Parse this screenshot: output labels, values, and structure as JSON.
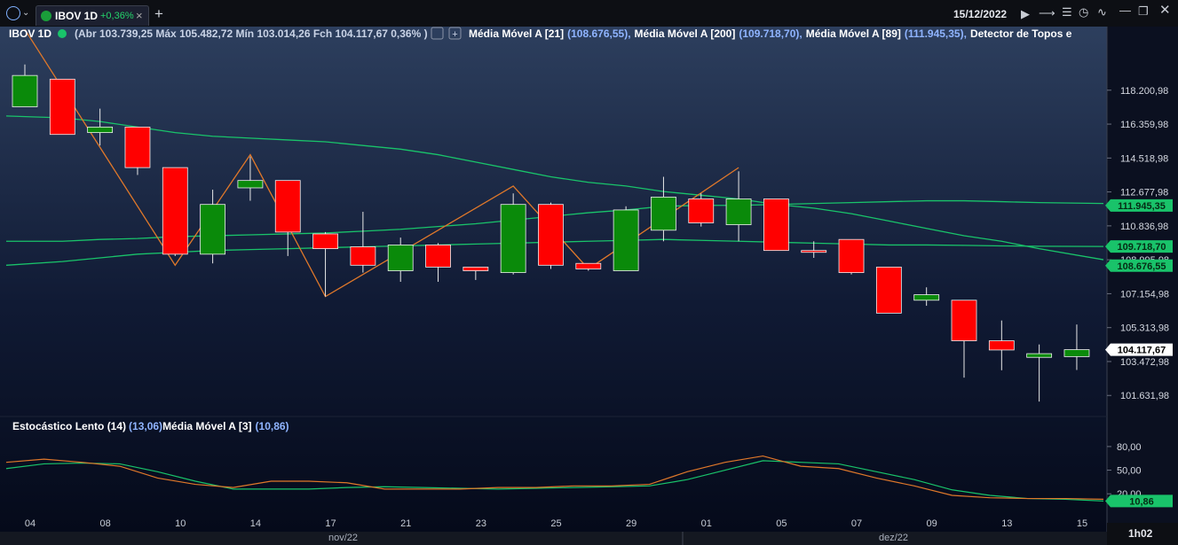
{
  "header": {
    "tab_label": "IBOV 1D",
    "tab_change": "+0,36%",
    "date": "15/12/2022",
    "add_tab": "+"
  },
  "legend": {
    "symbol": "IBOV 1D",
    "ohlc_text": "(Abr 103.739,25 Máx 105.482,72 Mín 103.014,26 Fch 104.117,67 0,36% )",
    "ma21": "Média Móvel A [21]",
    "ma21_val": "(108.676,55),",
    "ma200": "Média Móvel A [200]",
    "ma200_val": "(109.718,70),",
    "ma89": "Média Móvel A [89]",
    "ma89_val": "(111.945,35),",
    "detector": "Detector de Topos e"
  },
  "stoch_legend": {
    "name": "Estocástico Lento (14)",
    "val": "(13,06)",
    "ma": "Média Móvel A [3]",
    "ma_val": "(10,86)"
  },
  "footer": {
    "month1": "nov/22",
    "month2": "dez/22",
    "timer": "1h02"
  },
  "colors": {
    "up": "#0a8a0a",
    "down": "#ff0000",
    "ma_line": "#19c36a",
    "zigzag": "#e0782a",
    "stoch_k": "#e0782a",
    "stoch_d": "#19c36a"
  },
  "chart_data": {
    "type": "candlestick",
    "y_ticks": [
      "118.200,98",
      "116.359,98",
      "114.518,98",
      "112.677,98",
      "110.836,98",
      "108.995,98",
      "107.154,98",
      "105.313,98",
      "103.472,98",
      "101.631,98"
    ],
    "y_tick_values": [
      118200.98,
      116359.98,
      114518.98,
      112677.98,
      110836.98,
      108995.98,
      107154.98,
      105313.98,
      103472.98,
      101631.98
    ],
    "ylim": [
      100970,
      120740
    ],
    "x_labels": [
      "04",
      "08",
      "10",
      "14",
      "17",
      "21",
      "23",
      "25",
      "29",
      "01",
      "05",
      "07",
      "09",
      "13",
      "15"
    ],
    "candles": [
      {
        "o": 117300,
        "h": 119600,
        "l": null,
        "c": 119000
      },
      {
        "o": 118800,
        "h": 118800,
        "l": 115800,
        "c": 115800
      },
      {
        "o": 115900,
        "h": 117200,
        "l": 115200,
        "c": 116200
      },
      {
        "o": 116200,
        "h": 116200,
        "l": 113600,
        "c": 114000
      },
      {
        "o": 114000,
        "h": 114000,
        "l": 109200,
        "c": 109300
      },
      {
        "o": 109300,
        "h": 112800,
        "l": 108800,
        "c": 112000
      },
      {
        "o": 112900,
        "h": 114600,
        "l": 112200,
        "c": 113300
      },
      {
        "o": 113300,
        "h": 113300,
        "l": 109200,
        "c": 110500
      },
      {
        "o": 110400,
        "h": 110500,
        "l": 107000,
        "c": 109600
      },
      {
        "o": 109700,
        "h": 111600,
        "l": 108300,
        "c": 108700
      },
      {
        "o": 108400,
        "h": 110200,
        "l": 107800,
        "c": 109800
      },
      {
        "o": 109800,
        "h": 109900,
        "l": 107800,
        "c": 108600
      },
      {
        "o": 108600,
        "h": 108600,
        "l": 107900,
        "c": 108400
      },
      {
        "o": 108300,
        "h": 112600,
        "l": 108200,
        "c": 112000
      },
      {
        "o": 112000,
        "h": 112100,
        "l": 108500,
        "c": 108700
      },
      {
        "o": 108800,
        "h": 108800,
        "l": 108400,
        "c": 108500
      },
      {
        "o": 108400,
        "h": 111900,
        "l": 108400,
        "c": 111700
      },
      {
        "o": 110600,
        "h": 113500,
        "l": 110000,
        "c": 112400
      },
      {
        "o": 112300,
        "h": 112600,
        "l": 110800,
        "c": 111000
      },
      {
        "o": 110900,
        "h": 113800,
        "l": 110000,
        "c": 112300
      },
      {
        "o": 112300,
        "h": 112300,
        "l": 109600,
        "c": 109500
      },
      {
        "o": 109500,
        "h": 110000,
        "l": 109100,
        "c": 109400
      },
      {
        "o": 110100,
        "h": 110100,
        "l": 108200,
        "c": 108300
      },
      {
        "o": 108600,
        "h": 108600,
        "l": 106100,
        "c": 106100
      },
      {
        "o": 106800,
        "h": 107500,
        "l": 106500,
        "c": 107100
      },
      {
        "o": 106800,
        "h": 106800,
        "l": 102600,
        "c": 104600
      },
      {
        "o": 104600,
        "h": 105700,
        "l": 103000,
        "c": 104100
      },
      {
        "o": 103700,
        "h": 104400,
        "l": 101300,
        "c": 103900
      },
      {
        "o": 103739.25,
        "h": 105482.72,
        "l": 103014.26,
        "c": 104117.67
      }
    ],
    "ma89": [
      116800,
      116700,
      116500,
      116200,
      115900,
      115700,
      115600,
      115500,
      115400,
      115200,
      115000,
      114700,
      114300,
      113900,
      113500,
      113200,
      113000,
      112700,
      112500,
      112300,
      112000,
      111800,
      111500,
      111100,
      110700,
      110300,
      110000,
      109600,
      109000
    ],
    "ma200": [
      110000,
      110000,
      110100,
      110150,
      110250,
      110300,
      110350,
      110400,
      110450,
      110550,
      110650,
      110800,
      110950,
      111150,
      111350,
      111550,
      111700,
      111900,
      111950,
      111950,
      112000,
      112050,
      112100,
      112150,
      112200,
      112200,
      112150,
      112100,
      112050
    ],
    "ma21": [
      108700,
      108900,
      109100,
      109300,
      109400,
      109500,
      109550,
      109600,
      109650,
      109700,
      109750,
      109800,
      109850,
      109900,
      109950,
      110000,
      110050,
      110100,
      110050,
      110000,
      109950,
      109900,
      109850,
      109800,
      109800,
      109780,
      109750,
      109730,
      109718.7
    ],
    "zigzag": [
      [
        0,
        121500
      ],
      [
        4,
        108700
      ],
      [
        6,
        114700
      ],
      [
        8,
        107000
      ],
      [
        13,
        113000
      ],
      [
        15,
        108500
      ],
      [
        19,
        114000
      ]
    ],
    "value_badges": [
      {
        "label": "111.945,35",
        "value": 111945.35
      },
      {
        "label": "109.718,70",
        "value": 109718.7
      },
      {
        "label": "108.676,55",
        "value": 108676.55
      },
      {
        "label": "104.117,67",
        "value": 104117.67
      }
    ],
    "stoch": {
      "ticks": [
        "80,00",
        "50,00",
        "20,00"
      ],
      "tick_values": [
        80,
        50,
        20
      ],
      "ylim": [
        0,
        90
      ],
      "k": [
        60,
        64,
        60,
        55,
        40,
        32,
        28,
        36,
        36,
        34,
        26,
        26,
        26,
        28,
        28,
        30,
        30,
        32,
        48,
        60,
        68,
        55,
        52,
        40,
        30,
        18,
        15,
        14,
        14,
        13.06
      ],
      "d": [
        52,
        58,
        59,
        58,
        48,
        36,
        26,
        26,
        26,
        28,
        29,
        28,
        27,
        26,
        27,
        28,
        29,
        30,
        38,
        50,
        62,
        60,
        58,
        48,
        38,
        25,
        18,
        14,
        13,
        10.86
      ],
      "badge": "10,86",
      "badge_value": 10.86
    }
  }
}
